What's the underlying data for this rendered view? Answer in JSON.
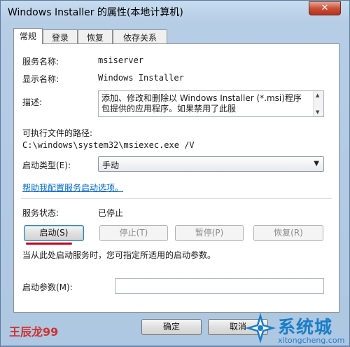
{
  "window": {
    "title": "Windows Installer 的属性(本地计算机)",
    "close_label": "✕"
  },
  "tabs": [
    {
      "label": "常规",
      "active": true
    },
    {
      "label": "登录",
      "active": false
    },
    {
      "label": "恢复",
      "active": false
    },
    {
      "label": "依存关系",
      "active": false
    }
  ],
  "general": {
    "service_name_label": "服务名称:",
    "service_name_value": "msiserver",
    "display_name_label": "显示名称:",
    "display_name_value": "Windows Installer",
    "description_label": "描述:",
    "description_value": "添加、修改和删除以 Windows Installer (*.msi)程序包提供的应用程序。如果禁用了此服",
    "path_label": "可执行文件的路径:",
    "path_value": "C:\\windows\\system32\\msiexec.exe /V",
    "startup_type_label": "启动类型(E):",
    "startup_type_value": "手动",
    "help_link": "帮助我配置服务启动选项。",
    "status_label": "服务状态:",
    "status_value": "已停止",
    "start_button": "启动(S)",
    "stop_button": "停止(T)",
    "pause_button": "暂停(P)",
    "resume_button": "恢复(R)",
    "hint_text": "当从此处启动服务时，您可指定所适用的启动参数。",
    "params_label": "启动参数(M):",
    "params_value": ""
  },
  "footer": {
    "ok_button": "确定",
    "cancel_button": "取消"
  },
  "overlay": {
    "author_watermark": "王辰龙99",
    "logo_text": "系统城",
    "logo_url": "xitongcheng.com"
  },
  "colors": {
    "link": "#0066cc",
    "highlight_underline": "#c8001e",
    "watermark_red": "#d0312d",
    "logo_blue": "#1a7ec8"
  }
}
